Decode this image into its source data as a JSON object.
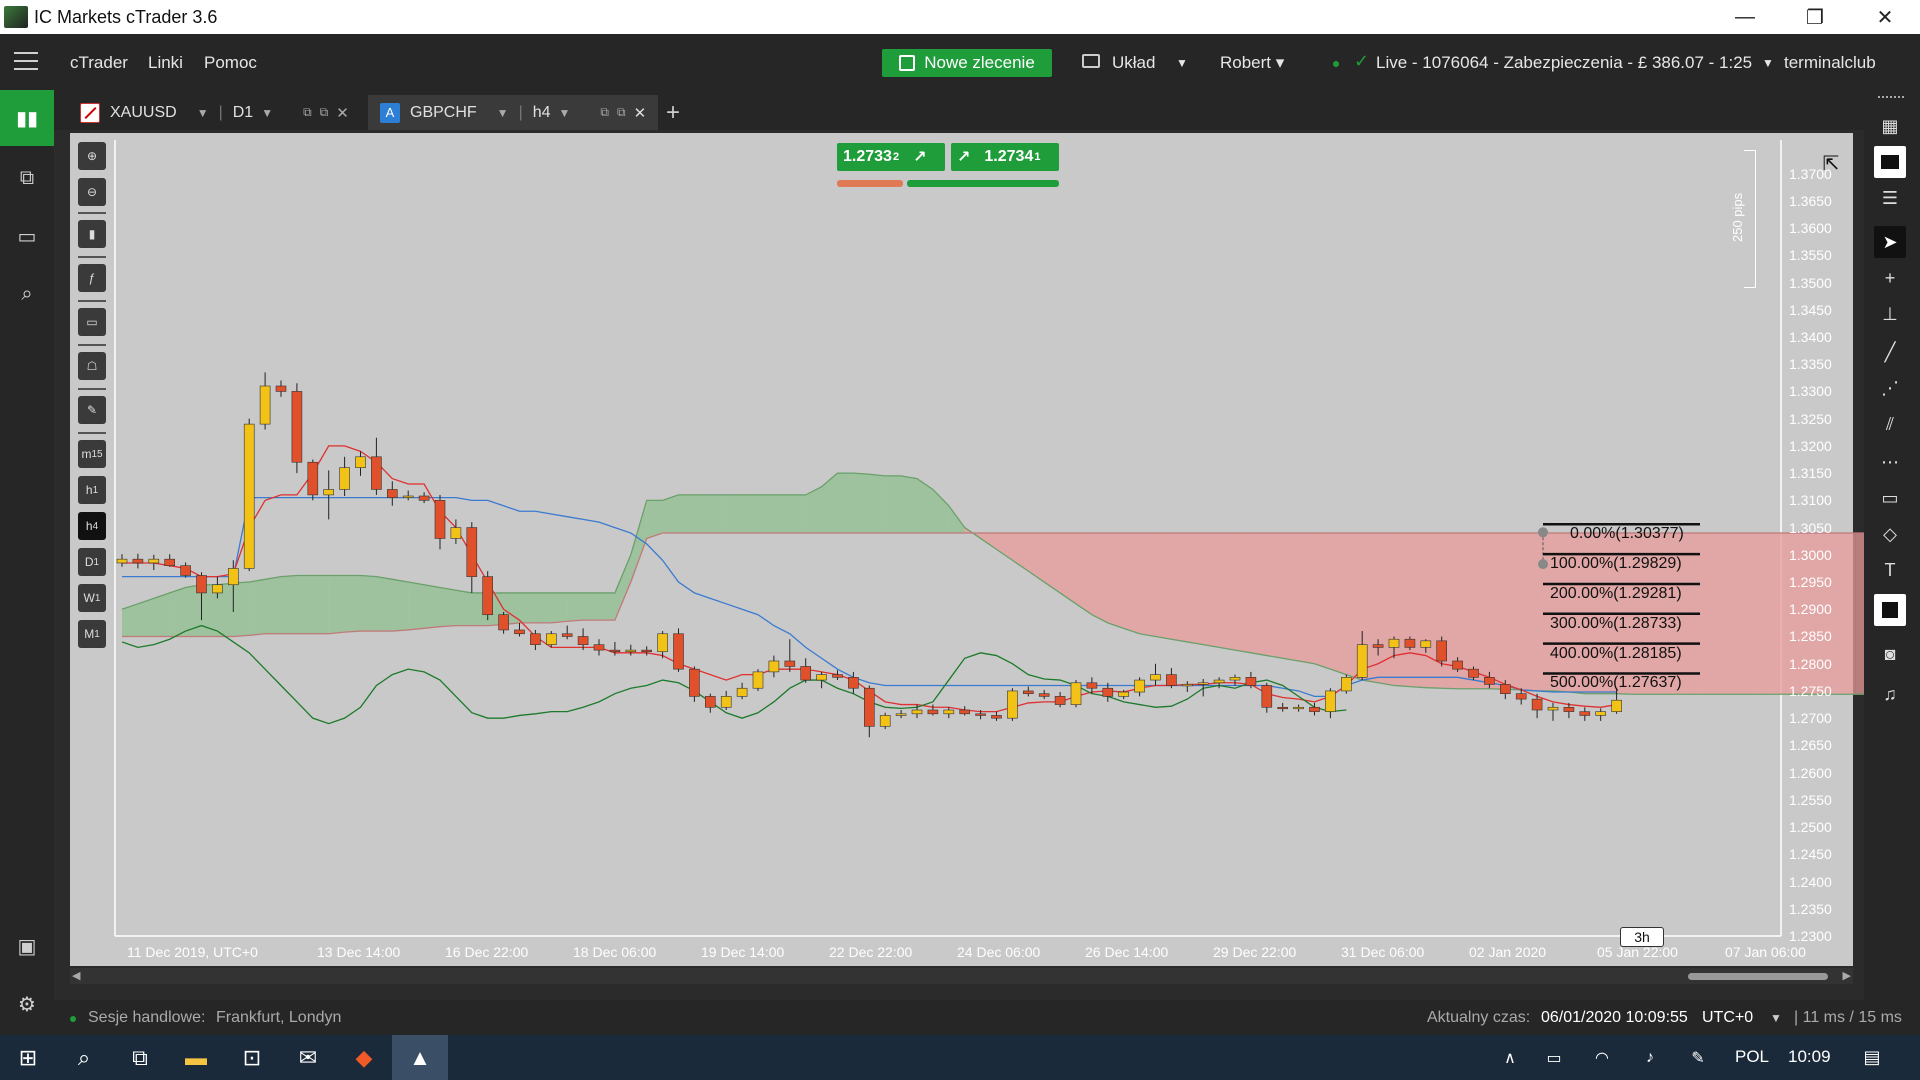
{
  "window": {
    "title": "IC Markets cTrader 3.6",
    "minimize_icon": "—",
    "restore_icon": "❐",
    "close_icon": "✕"
  },
  "menubar": {
    "items": [
      "cTrader",
      "Linki",
      "Pomoc"
    ],
    "new_order_label": "Nowe zlecenie",
    "layout_label": "Układ",
    "user_label": "Robert ▾",
    "account_label": "Live  - 1076064 - Zabezpieczenia - £ 386.07 - 1:25",
    "broker_label": "terminalclub"
  },
  "tabs": [
    {
      "symbol": "XAUUSD",
      "timeframe": "D1",
      "active": false
    },
    {
      "symbol": "GBPCHF",
      "timeframe": "h4",
      "active": true,
      "icon_letter": "A"
    }
  ],
  "new_tab_icon": "+",
  "quote": {
    "sell_main": "1.2733",
    "sell_pip": "2",
    "buy_main": "1.2734",
    "buy_pip": "1"
  },
  "price_scale": [
    "1.3700",
    "1.3650",
    "1.3600",
    "1.3550",
    "1.3500",
    "1.3450",
    "1.3400",
    "1.3350",
    "1.3300",
    "1.3250",
    "1.3200",
    "1.3150",
    "1.3100",
    "1.3050",
    "1.3000",
    "1.2950",
    "1.2900",
    "1.2850",
    "1.2800",
    "1.2750",
    "1.2700",
    "1.2650",
    "1.2600",
    "1.2550",
    "1.2500",
    "1.2450",
    "1.2400",
    "1.2350",
    "1.2300"
  ],
  "time_scale": [
    "11 Dec 2019, UTC+0",
    "13 Dec 14:00",
    "16 Dec 22:00",
    "18 Dec 06:00",
    "19 Dec 14:00",
    "22 Dec 22:00",
    "24 Dec 06:00",
    "26 Dec 14:00",
    "29 Dec 22:00",
    "31 Dec 06:00",
    "02 Jan 2020",
    "05 Jan 22:00",
    "07 Jan 06:00"
  ],
  "pip_range_label": "250 pips",
  "countdown_label": "3h",
  "left_tools": [
    "zoom-in-icon",
    "zoom-out-icon",
    "candles-icon",
    "indicators-icon",
    "bot-icon",
    "template-icon",
    "settings-icon"
  ],
  "left_timeframes": [
    {
      "label": "m",
      "sub": "15"
    },
    {
      "label": "h",
      "sub": "1"
    },
    {
      "label": "h",
      "sub": "4",
      "active": true
    },
    {
      "label": "D",
      "sub": "1"
    },
    {
      "label": "W",
      "sub": "1"
    },
    {
      "label": "M",
      "sub": "1"
    }
  ],
  "chart_data": {
    "type": "candlestick",
    "symbol": "GBPCHF",
    "timeframe": "h4",
    "ylim": [
      1.23,
      1.3725
    ],
    "grid": false,
    "colors": {
      "bull": "#f2c217",
      "bear": "#e0502a",
      "tenkan": "#e03030",
      "kijun": "#3a7ad0",
      "chikou": "#1c7a2a",
      "kumo_bull": "#8fbf8f",
      "kumo_bear": "#e89a9a"
    },
    "candles": [
      [
        1.2985,
        1.3001,
        1.2978,
        1.2992
      ],
      [
        1.2992,
        1.3002,
        1.2975,
        1.2985
      ],
      [
        1.2985,
        1.3,
        1.2972,
        1.2992
      ],
      [
        1.2992,
        1.3001,
        1.2978,
        1.298
      ],
      [
        1.298,
        1.2986,
        1.2958,
        1.2962
      ],
      [
        1.2962,
        1.2968,
        1.288,
        1.293
      ],
      [
        1.293,
        1.296,
        1.292,
        1.2945
      ],
      [
        1.2945,
        1.299,
        1.2895,
        1.2975
      ],
      [
        1.2975,
        1.325,
        1.297,
        1.324
      ],
      [
        1.324,
        1.3335,
        1.323,
        1.331
      ],
      [
        1.331,
        1.332,
        1.329,
        1.33
      ],
      [
        1.33,
        1.3315,
        1.315,
        1.317
      ],
      [
        1.317,
        1.3175,
        1.31,
        1.311
      ],
      [
        1.311,
        1.3155,
        1.3065,
        1.312
      ],
      [
        1.312,
        1.318,
        1.3108,
        1.316
      ],
      [
        1.316,
        1.319,
        1.3145,
        1.318
      ],
      [
        1.318,
        1.3215,
        1.311,
        1.312
      ],
      [
        1.312,
        1.3135,
        1.309,
        1.3105
      ],
      [
        1.3105,
        1.3118,
        1.31,
        1.3108
      ],
      [
        1.3108,
        1.3115,
        1.3095,
        1.31
      ],
      [
        1.31,
        1.311,
        1.301,
        1.303
      ],
      [
        1.303,
        1.3065,
        1.302,
        1.305
      ],
      [
        1.305,
        1.306,
        1.293,
        1.296
      ],
      [
        1.296,
        1.297,
        1.288,
        1.289
      ],
      [
        1.289,
        1.2895,
        1.2855,
        1.2862
      ],
      [
        1.2862,
        1.2875,
        1.285,
        1.2855
      ],
      [
        1.2855,
        1.2862,
        1.2825,
        1.2835
      ],
      [
        1.2835,
        1.286,
        1.283,
        1.2855
      ],
      [
        1.2855,
        1.287,
        1.2845,
        1.285
      ],
      [
        1.285,
        1.2865,
        1.2825,
        1.2835
      ],
      [
        1.2835,
        1.2845,
        1.2815,
        1.2825
      ],
      [
        1.2825,
        1.284,
        1.2815,
        1.2822
      ],
      [
        1.2822,
        1.2835,
        1.2815,
        1.2825
      ],
      [
        1.2825,
        1.2832,
        1.2815,
        1.2822
      ],
      [
        1.2822,
        1.286,
        1.281,
        1.2855
      ],
      [
        1.2855,
        1.2865,
        1.2785,
        1.279
      ],
      [
        1.279,
        1.2795,
        1.273,
        1.274
      ],
      [
        1.274,
        1.2745,
        1.271,
        1.272
      ],
      [
        1.272,
        1.275,
        1.2715,
        1.274
      ],
      [
        1.274,
        1.2765,
        1.2735,
        1.2755
      ],
      [
        1.2755,
        1.279,
        1.275,
        1.2785
      ],
      [
        1.2785,
        1.2815,
        1.2775,
        1.2805
      ],
      [
        1.2805,
        1.2845,
        1.2785,
        1.2795
      ],
      [
        1.2795,
        1.281,
        1.2765,
        1.277
      ],
      [
        1.277,
        1.2785,
        1.2755,
        1.278
      ],
      [
        1.278,
        1.2788,
        1.277,
        1.2775
      ],
      [
        1.2775,
        1.2785,
        1.2745,
        1.2755
      ],
      [
        1.2755,
        1.276,
        1.2665,
        1.2685
      ],
      [
        1.2685,
        1.271,
        1.268,
        1.2705
      ],
      [
        1.2705,
        1.2715,
        1.27,
        1.2708
      ],
      [
        1.2708,
        1.2725,
        1.27,
        1.2715
      ],
      [
        1.2715,
        1.2725,
        1.2705,
        1.2708
      ],
      [
        1.2708,
        1.272,
        1.27,
        1.2715
      ],
      [
        1.2715,
        1.2722,
        1.2705,
        1.2708
      ],
      [
        1.2708,
        1.2715,
        1.2698,
        1.2705
      ],
      [
        1.2705,
        1.2712,
        1.2695,
        1.27
      ],
      [
        1.27,
        1.2755,
        1.2695,
        1.275
      ],
      [
        1.275,
        1.2758,
        1.274,
        1.2745
      ],
      [
        1.2745,
        1.2752,
        1.2735,
        1.274
      ],
      [
        1.274,
        1.2748,
        1.272,
        1.2725
      ],
      [
        1.2725,
        1.277,
        1.272,
        1.2765
      ],
      [
        1.2765,
        1.2775,
        1.2745,
        1.2755
      ],
      [
        1.2755,
        1.2765,
        1.273,
        1.274
      ],
      [
        1.274,
        1.2752,
        1.2735,
        1.2748
      ],
      [
        1.2748,
        1.2775,
        1.274,
        1.277
      ],
      [
        1.277,
        1.28,
        1.276,
        1.278
      ],
      [
        1.278,
        1.2792,
        1.2755,
        1.276
      ],
      [
        1.276,
        1.2768,
        1.2748,
        1.2762
      ],
      [
        1.2762,
        1.2772,
        1.274,
        1.2765
      ],
      [
        1.2765,
        1.2775,
        1.2755,
        1.277
      ],
      [
        1.277,
        1.278,
        1.276,
        1.2775
      ],
      [
        1.2775,
        1.2785,
        1.2755,
        1.276
      ],
      [
        1.276,
        1.2765,
        1.271,
        1.272
      ],
      [
        1.272,
        1.2728,
        1.2712,
        1.2718
      ],
      [
        1.2718,
        1.2725,
        1.2712,
        1.272
      ],
      [
        1.272,
        1.2728,
        1.2705,
        1.2712
      ],
      [
        1.2712,
        1.2755,
        1.27,
        1.275
      ],
      [
        1.275,
        1.278,
        1.2745,
        1.2775
      ],
      [
        1.2775,
        1.286,
        1.277,
        1.2835
      ],
      [
        1.2835,
        1.2845,
        1.2815,
        1.283
      ],
      [
        1.283,
        1.285,
        1.281,
        1.2845
      ],
      [
        1.2845,
        1.285,
        1.2825,
        1.283
      ],
      [
        1.283,
        1.2845,
        1.282,
        1.2842
      ],
      [
        1.2842,
        1.285,
        1.2795,
        1.2805
      ],
      [
        1.2805,
        1.2812,
        1.2785,
        1.279
      ],
      [
        1.279,
        1.2795,
        1.277,
        1.2775
      ],
      [
        1.2775,
        1.2785,
        1.2755,
        1.2762
      ],
      [
        1.2762,
        1.277,
        1.2735,
        1.2745
      ],
      [
        1.2745,
        1.2755,
        1.2725,
        1.2735
      ],
      [
        1.2735,
        1.2745,
        1.27,
        1.2715
      ],
      [
        1.2715,
        1.2728,
        1.2695,
        1.272
      ],
      [
        1.272,
        1.2728,
        1.27,
        1.2712
      ],
      [
        1.2712,
        1.272,
        1.2695,
        1.2705
      ],
      [
        1.2705,
        1.2718,
        1.2695,
        1.2712
      ],
      [
        1.2712,
        1.2755,
        1.2708,
        1.2733
      ]
    ],
    "tenkan": [
      1.2985,
      1.2985,
      1.2985,
      1.298,
      1.2975,
      1.296,
      1.296,
      1.2965,
      1.305,
      1.31,
      1.311,
      1.311,
      1.315,
      1.32,
      1.32,
      1.319,
      1.317,
      1.314,
      1.313,
      1.313,
      1.308,
      1.305,
      1.3,
      1.295,
      1.29,
      1.288,
      1.285,
      1.283,
      1.283,
      1.283,
      1.283,
      1.282,
      1.282,
      1.282,
      1.2815,
      1.28,
      1.279,
      1.278,
      1.277,
      1.278,
      1.278,
      1.279,
      1.279,
      1.279,
      1.2785,
      1.278,
      1.277,
      1.275,
      1.273,
      1.2725,
      1.2725,
      1.272,
      1.272,
      1.2715,
      1.2712,
      1.2712,
      1.272,
      1.2728,
      1.273,
      1.273,
      1.274,
      1.2748,
      1.275,
      1.2748,
      1.2755,
      1.276,
      1.276,
      1.2762,
      1.2762,
      1.2765,
      1.2765,
      1.2762,
      1.2745,
      1.2738,
      1.2735,
      1.273,
      1.274,
      1.276,
      1.279,
      1.28,
      1.2815,
      1.282,
      1.2815,
      1.28,
      1.2795,
      1.2785,
      1.2775,
      1.2762,
      1.2752,
      1.274,
      1.273,
      1.2725,
      1.2722,
      1.272,
      1.2725
    ],
    "kijun": [
      1.296,
      1.296,
      1.296,
      1.296,
      1.296,
      1.296,
      1.296,
      1.296,
      1.3105,
      1.3105,
      1.3105,
      1.3105,
      1.3105,
      1.3105,
      1.3105,
      1.3105,
      1.3105,
      1.3105,
      1.3105,
      1.3105,
      1.3105,
      1.3105,
      1.31,
      1.31,
      1.309,
      1.308,
      1.308,
      1.3075,
      1.307,
      1.3065,
      1.306,
      1.305,
      1.304,
      1.302,
      1.299,
      1.295,
      1.293,
      1.292,
      1.291,
      1.29,
      1.289,
      1.287,
      1.2855,
      1.283,
      1.281,
      1.279,
      1.2775,
      1.2765,
      1.276,
      1.276,
      1.276,
      1.276,
      1.276,
      1.276,
      1.276,
      1.276,
      1.276,
      1.276,
      1.276,
      1.276,
      1.276,
      1.276,
      1.276,
      1.276,
      1.276,
      1.276,
      1.276,
      1.276,
      1.276,
      1.276,
      1.276,
      1.276,
      1.276,
      1.2755,
      1.275,
      1.274,
      1.274,
      1.276,
      1.277,
      1.2775,
      1.2775,
      1.2775,
      1.2775,
      1.2775,
      1.2775,
      1.277,
      1.2765,
      1.276,
      1.2752,
      1.275,
      1.2748,
      1.2748,
      1.2748,
      1.2748,
      1.2748
    ],
    "chikou": [
      1.284,
      1.283,
      1.2835,
      1.2845,
      1.286,
      1.287,
      1.286,
      1.284,
      1.282,
      1.279,
      1.276,
      1.273,
      1.27,
      1.269,
      1.27,
      1.272,
      1.276,
      1.278,
      1.279,
      1.2785,
      1.277,
      1.274,
      1.271,
      1.27,
      1.27,
      1.2705,
      1.2708,
      1.2712,
      1.2712,
      1.272,
      1.273,
      1.2745,
      1.2755,
      1.276,
      1.277,
      1.2765,
      1.275,
      1.273,
      1.271,
      1.27,
      1.271,
      1.273,
      1.2755,
      1.277,
      1.277,
      1.2755,
      1.2745,
      1.273,
      1.272,
      1.2718,
      1.272,
      1.273,
      1.277,
      1.281,
      1.282,
      1.2815,
      1.28,
      1.278,
      1.2772,
      1.277,
      1.276,
      1.2745,
      1.274,
      1.273,
      1.2725,
      1.272,
      1.2722,
      1.2735,
      1.2755,
      1.276,
      1.2755,
      1.2765,
      1.277,
      1.276,
      1.274,
      1.272,
      1.2712,
      1.2715
    ],
    "senkou_a": [
      1.29,
      1.291,
      1.292,
      1.293,
      1.294,
      1.2945,
      1.2945,
      1.2948,
      1.295,
      1.2955,
      1.296,
      1.2962,
      1.2962,
      1.2962,
      1.2962,
      1.2962,
      1.296,
      1.2955,
      1.295,
      1.2945,
      1.294,
      1.2935,
      1.293,
      1.293,
      1.293,
      1.293,
      1.293,
      1.293,
      1.293,
      1.293,
      1.293,
      1.293,
      1.3,
      1.31,
      1.31,
      1.311,
      1.311,
      1.311,
      1.311,
      1.311,
      1.311,
      1.311,
      1.311,
      1.311,
      1.3125,
      1.315,
      1.315,
      1.3148,
      1.3145,
      1.3145,
      1.314,
      1.312,
      1.309,
      1.305,
      1.303,
      1.301,
      1.299,
      1.297,
      1.295,
      1.293,
      1.291,
      1.289,
      1.2875,
      1.2865,
      1.2855,
      1.285,
      1.2845,
      1.284,
      1.2835,
      1.283,
      1.2825,
      1.282,
      1.2815,
      1.281,
      1.2805,
      1.28,
      1.279,
      1.278,
      1.277,
      1.2765,
      1.276,
      1.2758,
      1.2756,
      1.2755,
      1.2754,
      1.2754,
      1.2754,
      1.2753,
      1.2752,
      1.275,
      1.275,
      1.2748,
      1.2745,
      1.2745,
      1.2745,
      1.2744,
      1.2744,
      1.2744,
      1.2744,
      1.2744,
      1.2744,
      1.2744,
      1.2744,
      1.2744,
      1.2744,
      1.2744,
      1.2744,
      1.2744,
      1.2744,
      1.2744,
      1.2744,
      1.2744,
      1.2744,
      1.2744,
      1.2744,
      1.2744,
      1.2744,
      1.2744,
      1.2744,
      1.2744,
      1.2744
    ],
    "senkou_b": [
      1.285,
      1.285,
      1.285,
      1.285,
      1.285,
      1.285,
      1.285,
      1.285,
      1.2852,
      1.2855,
      1.2855,
      1.2855,
      1.2855,
      1.2855,
      1.2858,
      1.286,
      1.286,
      1.286,
      1.2862,
      1.2865,
      1.2868,
      1.287,
      1.287,
      1.287,
      1.2872,
      1.2875,
      1.2875,
      1.2875,
      1.2878,
      1.288,
      1.288,
      1.288,
      1.295,
      1.303,
      1.304,
      1.304,
      1.304,
      1.304,
      1.304,
      1.304,
      1.304,
      1.304,
      1.304,
      1.304,
      1.304,
      1.304,
      1.304,
      1.304,
      1.304,
      1.304,
      1.304,
      1.304,
      1.304,
      1.304,
      1.304,
      1.304,
      1.304,
      1.304,
      1.304,
      1.304,
      1.304,
      1.304,
      1.304,
      1.304,
      1.304,
      1.304,
      1.304,
      1.304,
      1.304,
      1.304,
      1.304,
      1.304,
      1.304,
      1.304,
      1.304,
      1.304,
      1.304,
      1.304,
      1.304,
      1.304,
      1.304,
      1.304,
      1.304,
      1.304,
      1.304,
      1.304,
      1.304,
      1.304,
      1.304,
      1.304,
      1.304,
      1.304,
      1.304,
      1.304,
      1.304,
      1.304,
      1.304,
      1.304,
      1.304,
      1.304,
      1.304,
      1.304,
      1.304,
      1.304,
      1.304,
      1.304,
      1.304,
      1.304,
      1.304,
      1.304,
      1.304,
      1.304,
      1.304,
      1.304,
      1.304,
      1.304,
      1.304,
      1.304,
      1.304,
      1.304,
      1.304
    ],
    "fib_levels": [
      {
        "label": "0.00%(1.30377)",
        "price": 1.30377
      },
      {
        "label": "100.00%(1.29829)",
        "price": 1.29829
      },
      {
        "label": "200.00%(1.29281)",
        "price": 1.29281
      },
      {
        "label": "300.00%(1.28733)",
        "price": 1.28733
      },
      {
        "label": "400.00%(1.28185)",
        "price": 1.28185
      },
      {
        "label": "500.00%(1.27637)",
        "price": 1.27637
      }
    ]
  },
  "status": {
    "sessions_label": "Sesje handlowe:",
    "sessions_value": "Frankfurt, Londyn",
    "time_label": "Aktualny czas:",
    "time_value": "06/01/2020 10:09:55",
    "tz": "UTC+0",
    "latency": "| 11 ms / 15 ms"
  },
  "taskbar": {
    "lang": "POL",
    "clock": "10:09"
  }
}
